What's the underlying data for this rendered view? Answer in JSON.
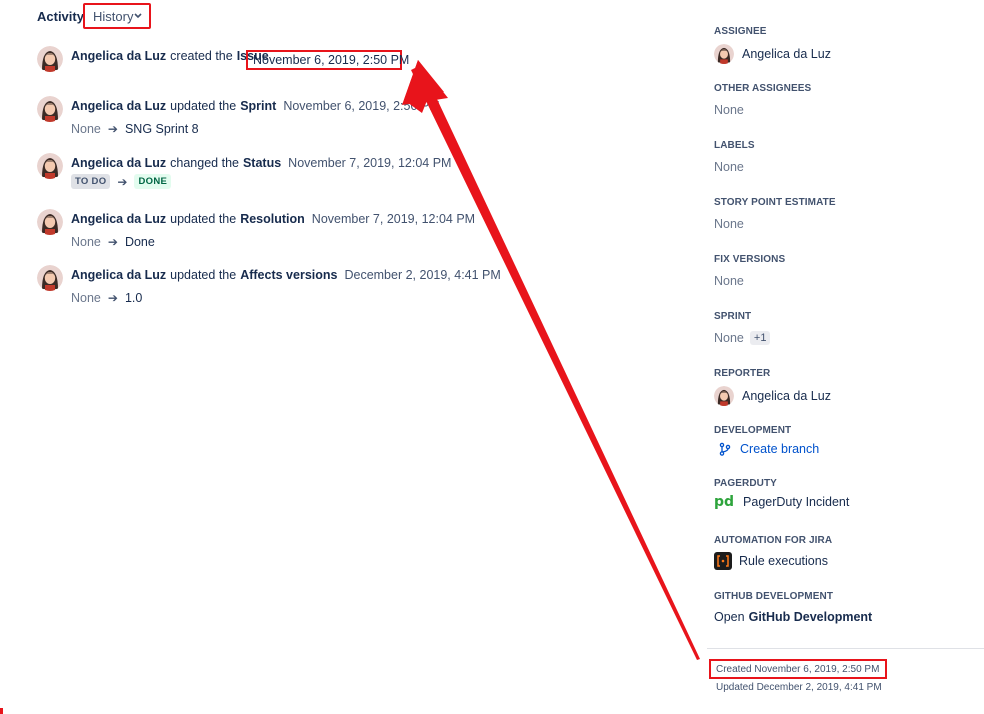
{
  "activity": {
    "title": "Activity",
    "filter_value": "History",
    "items": [
      {
        "who": "Angelica da Luz",
        "verb": "created the",
        "field": "Issue",
        "date": "November 6, 2019, 2:50 PM"
      },
      {
        "who": "Angelica da Luz",
        "verb": "updated the",
        "field": "Sprint",
        "date": "November 6, 2019, 2:50 PM",
        "from": "None",
        "to": "SNG Sprint 8"
      },
      {
        "who": "Angelica da Luz",
        "verb": "changed the",
        "field": "Status",
        "date": "November 7, 2019, 12:04 PM",
        "from": "TO DO",
        "to": "DONE"
      },
      {
        "who": "Angelica da Luz",
        "verb": "updated the",
        "field": "Resolution",
        "date": "November 7, 2019, 12:04 PM",
        "from": "None",
        "to": "Done"
      },
      {
        "who": "Angelica da Luz",
        "verb": "updated the",
        "field": "Affects versions",
        "date": "December 2, 2019, 4:41 PM",
        "from": "None",
        "to": "1.0"
      }
    ]
  },
  "sidebar": {
    "assignee": {
      "label": "ASSIGNEE",
      "value": "Angelica da Luz"
    },
    "other_assignees": {
      "label": "OTHER ASSIGNEES",
      "value": "None"
    },
    "labels": {
      "label": "LABELS",
      "value": "None"
    },
    "story_points": {
      "label": "STORY POINT ESTIMATE",
      "value": "None"
    },
    "fix_versions": {
      "label": "FIX VERSIONS",
      "value": "None"
    },
    "sprint": {
      "label": "SPRINT",
      "value": "None",
      "extra": "+1"
    },
    "reporter": {
      "label": "REPORTER",
      "value": "Angelica da Luz"
    },
    "development": {
      "label": "DEVELOPMENT",
      "value": "Create branch"
    },
    "pagerduty": {
      "label": "PAGERDUTY",
      "logo": "pd",
      "value": "PagerDuty Incident"
    },
    "automation": {
      "label": "AUTOMATION FOR JIRA",
      "value": "Rule executions"
    },
    "github": {
      "label": "GITHUB DEVELOPMENT",
      "prefix": "Open",
      "value": "GitHub Development"
    }
  },
  "footer": {
    "created": "Created November 6, 2019, 2:50 PM",
    "updated": "Updated December 2, 2019, 4:41 PM"
  },
  "colors": {
    "highlight": "#e8141b",
    "link": "#0052cc",
    "text": "#172b4d"
  }
}
